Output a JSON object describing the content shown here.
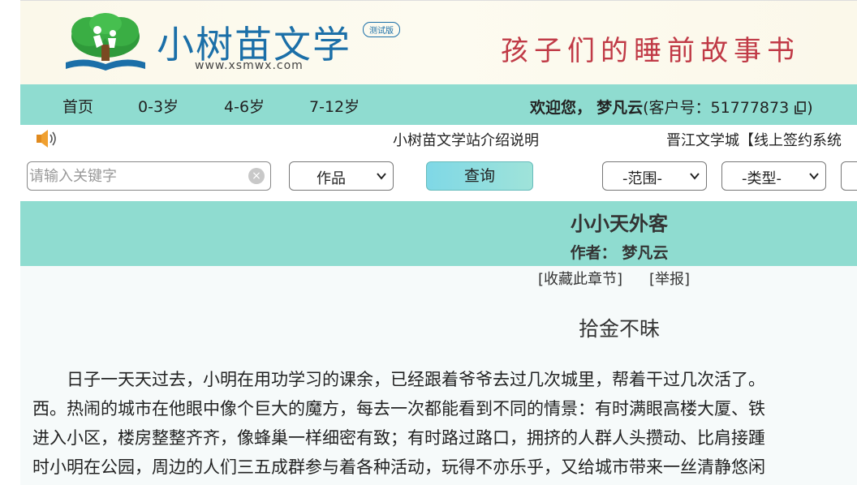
{
  "header": {
    "site_title": "小树苗文学",
    "site_url": "www.xsmwx.com",
    "beta_badge": "测试版",
    "slogan": "孩子们的睡前故事书"
  },
  "nav": {
    "items": [
      {
        "label": "首页"
      },
      {
        "label": "0-3岁"
      },
      {
        "label": "4-6岁"
      },
      {
        "label": "7-12岁"
      }
    ],
    "welcome_prefix": "欢迎您，",
    "username": "梦凡云",
    "customer_label": "(客户号：51777873",
    "customer_suffix": ")"
  },
  "notice": {
    "items": [
      {
        "label": "小树苗文学站介绍说明"
      },
      {
        "label": "晋江文学城【线上签约系统"
      }
    ]
  },
  "search": {
    "placeholder": "请输入关键字",
    "type_select": "作品",
    "query_label": "查询",
    "range_select": "-范围-",
    "category_select": "-类型-"
  },
  "article": {
    "title": "小小天外客",
    "author_label": "作者：",
    "author": "梦凡云",
    "favorite_label": "[收藏此章节]",
    "report_label": "[举报]",
    "chapter_title": "拾金不昧",
    "lines": [
      "　　日子一天天过去，小明在用功学习的课余，已经跟着爷爷去过几次城里，帮着干过几次活了。",
      "西。热闹的城市在他眼中像个巨大的魔方，每去一次都能看到不同的情景：有时满眼高楼大厦、铁",
      "进入小区，楼房整整齐齐，像蜂巢一样细密有致；有时路过路口，拥挤的人群人头攒动、比肩接踵",
      "时小明在公园，周边的人们三五成群参与着各种活动，玩得不亦乐乎，又给城市带来一丝清静悠闲"
    ]
  },
  "colors": {
    "nav_bg": "#8fdcd0",
    "slogan": "#c03a46",
    "logo_blue": "#1b6fa8"
  }
}
